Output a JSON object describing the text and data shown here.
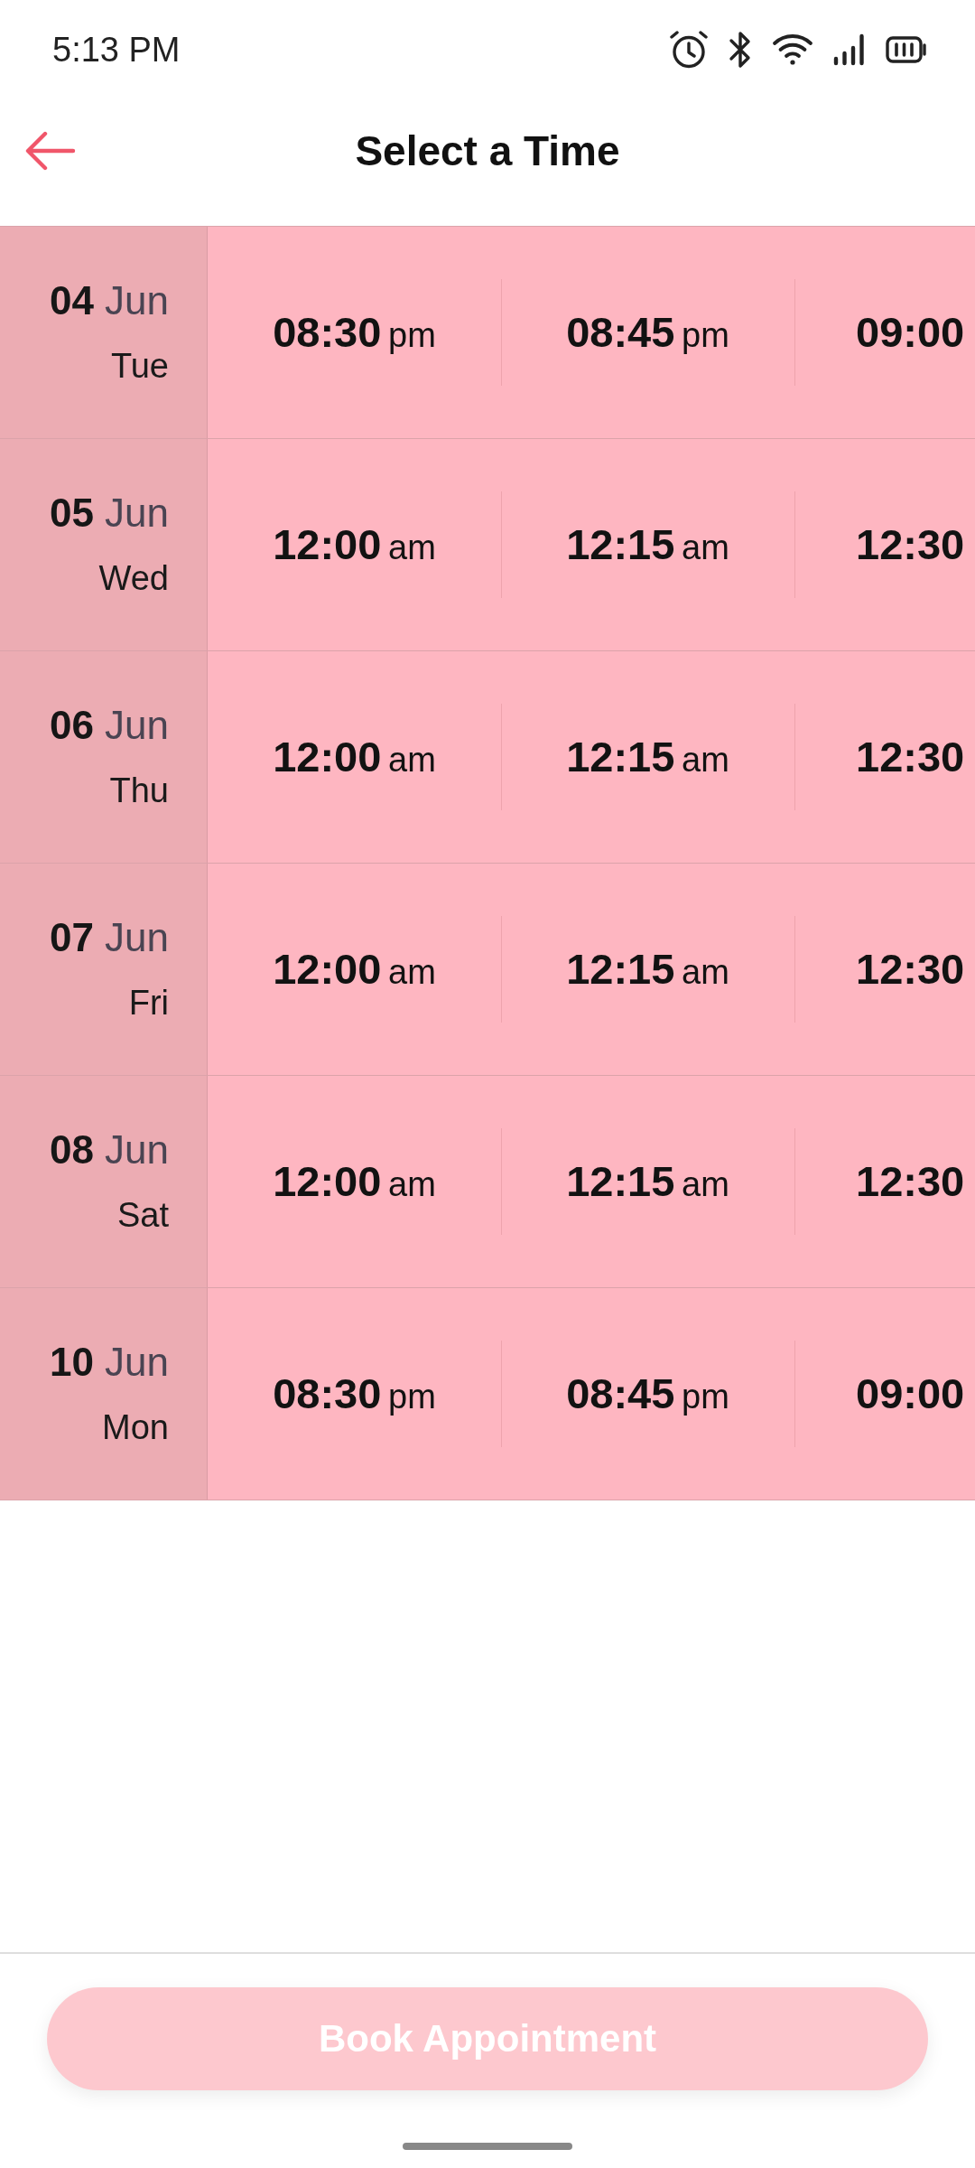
{
  "status_bar": {
    "time": "5:13 PM"
  },
  "header": {
    "title": "Select a Time"
  },
  "schedule": [
    {
      "day": "04",
      "month": "Jun",
      "weekday": "Tue",
      "slots": [
        {
          "time": "08:30",
          "period": "pm",
          "selected": false
        },
        {
          "time": "08:45",
          "period": "pm",
          "selected": false
        },
        {
          "time": "09:00",
          "selected": false
        }
      ]
    },
    {
      "day": "05",
      "month": "Jun",
      "weekday": "Wed",
      "slots": [
        {
          "time": "12:00",
          "period": "am",
          "selected": false
        },
        {
          "time": "12:15",
          "period": "am",
          "selected": false
        },
        {
          "time": "12:30",
          "selected": false
        }
      ]
    },
    {
      "day": "06",
      "month": "Jun",
      "weekday": "Thu",
      "slots": [
        {
          "time": "12:00",
          "period": "am",
          "selected": false
        },
        {
          "time": "12:15",
          "period": "am",
          "selected": false
        },
        {
          "time": "12:30",
          "selected": false
        }
      ]
    },
    {
      "day": "07",
      "month": "Jun",
      "weekday": "Fri",
      "slots": [
        {
          "time": "12:00",
          "period": "am",
          "selected": false
        },
        {
          "time": "12:15",
          "period": "am",
          "selected": false
        },
        {
          "time": "12:30",
          "selected": false
        }
      ]
    },
    {
      "day": "08",
      "month": "Jun",
      "weekday": "Sat",
      "slots": [
        {
          "time": "12:00",
          "period": "am",
          "selected": false
        },
        {
          "time": "12:15",
          "period": "am",
          "selected": false
        },
        {
          "time": "12:30",
          "selected": false
        }
      ]
    },
    {
      "day": "10",
      "month": "Jun",
      "weekday": "Mon",
      "slots": [
        {
          "time": "08:30",
          "period": "pm",
          "selected": false
        },
        {
          "time": "08:45",
          "period": "pm",
          "selected": false
        },
        {
          "time": "09:00",
          "selected": false
        }
      ]
    }
  ],
  "book_button": {
    "label": "Book Appointment",
    "disabled": true
  }
}
